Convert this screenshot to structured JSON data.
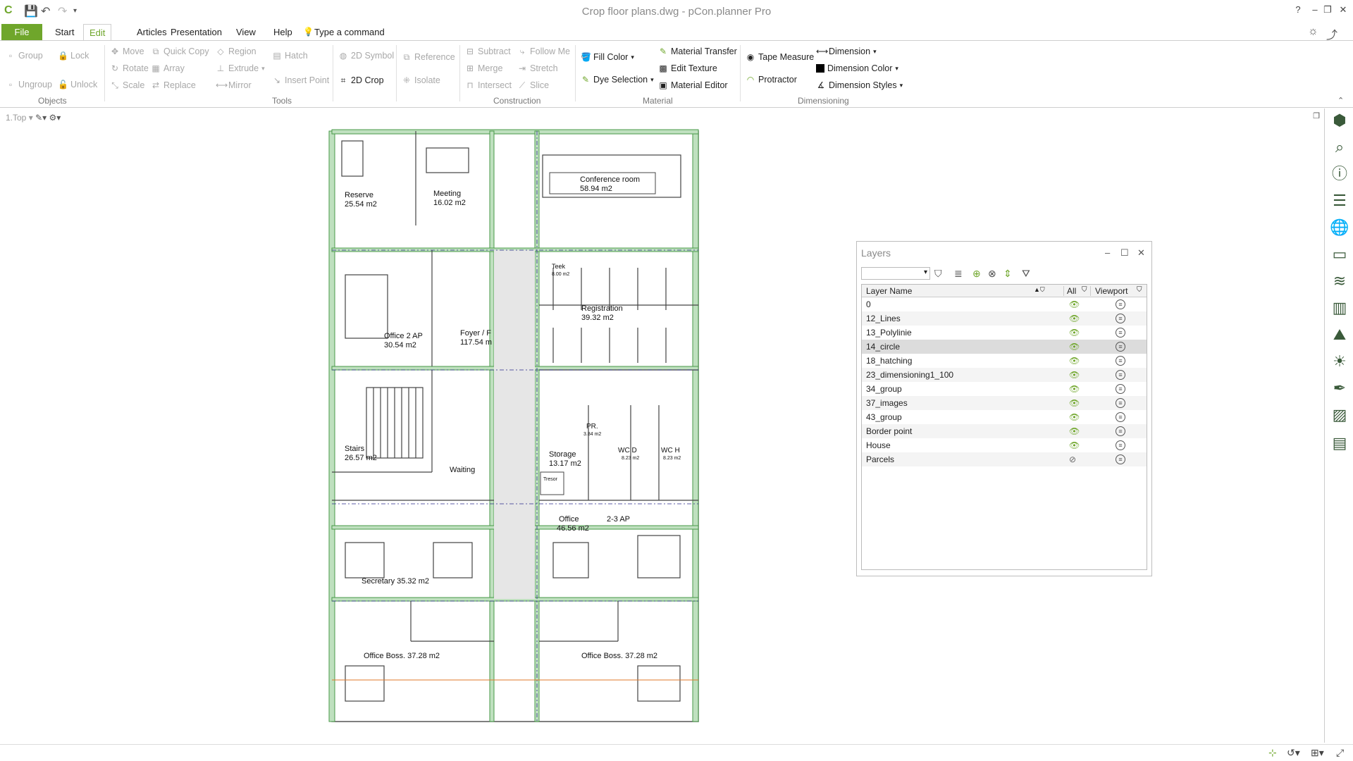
{
  "app": {
    "title": "Crop floor plans.dwg - pCon.planner Pro"
  },
  "titlebar": {
    "help": "?",
    "minimize": "–",
    "restore": "❐",
    "close": "✕"
  },
  "tabs": {
    "file": "File",
    "start": "Start",
    "edit": "Edit",
    "articles": "Articles",
    "presentation": "Presentation",
    "view": "View",
    "help": "Help"
  },
  "command": {
    "placeholder": "Type a command"
  },
  "ribbon": {
    "objects": {
      "label": "Objects",
      "group": "Group",
      "lock": "Lock",
      "ungroup": "Ungroup",
      "unlock": "Unlock"
    },
    "tools": {
      "label": "Tools",
      "move": "Move",
      "quick_copy": "Quick Copy",
      "region": "Region",
      "hatch": "Hatch",
      "rotate": "Rotate",
      "array": "Array",
      "extrude": "Extrude",
      "scale": "Scale",
      "replace": "Replace",
      "mirror": "Mirror",
      "insert_point": "Insert Point",
      "symbol_2d": "2D Symbol",
      "crop_2d": "2D Crop",
      "reference": "Reference",
      "isolate": "Isolate"
    },
    "construction": {
      "label": "Construction",
      "subtract": "Subtract",
      "follow_me": "Follow Me",
      "merge": "Merge",
      "stretch": "Stretch",
      "intersect": "Intersect",
      "slice": "Slice"
    },
    "material": {
      "label": "Material",
      "fill_color": "Fill Color",
      "dye_selection": "Dye Selection",
      "material_transfer": "Material Transfer",
      "edit_texture": "Edit Texture",
      "material_editor": "Material Editor"
    },
    "dimensioning": {
      "label": "Dimensioning",
      "tape_measure": "Tape Measure",
      "protractor": "Protractor",
      "dimension": "Dimension",
      "dimension_color": "Dimension Color",
      "dimension_styles": "Dimension Styles"
    }
  },
  "viewport": {
    "view_name": "1.Top"
  },
  "plan": {
    "rooms": [
      {
        "name": "Reserve",
        "area": "25.54 m2"
      },
      {
        "name": "Meeting",
        "area": "16.02 m2"
      },
      {
        "name": "Conference room",
        "area": "58.94 m2"
      },
      {
        "name": "Office 2 AP",
        "area": "30.54 m2"
      },
      {
        "name": "Foyer / F",
        "area": "117.54 m"
      },
      {
        "name": "Teek",
        "area": "8.00 m2"
      },
      {
        "name": "Registration",
        "area": "39.32 m2"
      },
      {
        "name": "Stairs",
        "area": "26.57 m2"
      },
      {
        "name": "Waiting",
        "area": ""
      },
      {
        "name": "PR.",
        "area": "3.84 m2"
      },
      {
        "name": "Storage",
        "area": "13.17 m2"
      },
      {
        "name": "WC D",
        "area": "8.23 m2"
      },
      {
        "name": "WC H",
        "area": "8.23 m2"
      },
      {
        "name": "Tresor",
        "area": ""
      },
      {
        "name": "Office",
        "area": "46.56 m2"
      },
      {
        "name": "2-3 AP",
        "area": ""
      },
      {
        "name": "Secretary 35.32 m2",
        "area": ""
      },
      {
        "name": "Office Boss. 37.28 m2",
        "area": ""
      },
      {
        "name": "Office Boss. 37.28 m2",
        "area": ""
      }
    ]
  },
  "layers": {
    "title": "Layers",
    "columns": {
      "name": "Layer Name",
      "all": "All",
      "viewport": "Viewport"
    },
    "rows": [
      {
        "name": "0",
        "visible": true
      },
      {
        "name": "12_Lines",
        "visible": true
      },
      {
        "name": "13_Polylinie",
        "visible": true
      },
      {
        "name": "14_circle",
        "visible": true,
        "selected": true
      },
      {
        "name": "18_hatching",
        "visible": true
      },
      {
        "name": "23_dimensioning1_100",
        "visible": true
      },
      {
        "name": "34_group",
        "visible": true
      },
      {
        "name": "37_images",
        "visible": true
      },
      {
        "name": "43_group",
        "visible": true
      },
      {
        "name": "Border point",
        "visible": true
      },
      {
        "name": "House",
        "visible": true
      },
      {
        "name": "Parcels",
        "visible": false
      }
    ]
  },
  "colors": {
    "accent": "#6fa62b",
    "wall": "#4a9a4a",
    "hatch": "#bfe0bf",
    "corridor": "#e6e6e6",
    "dim": "#2a2a8a"
  }
}
